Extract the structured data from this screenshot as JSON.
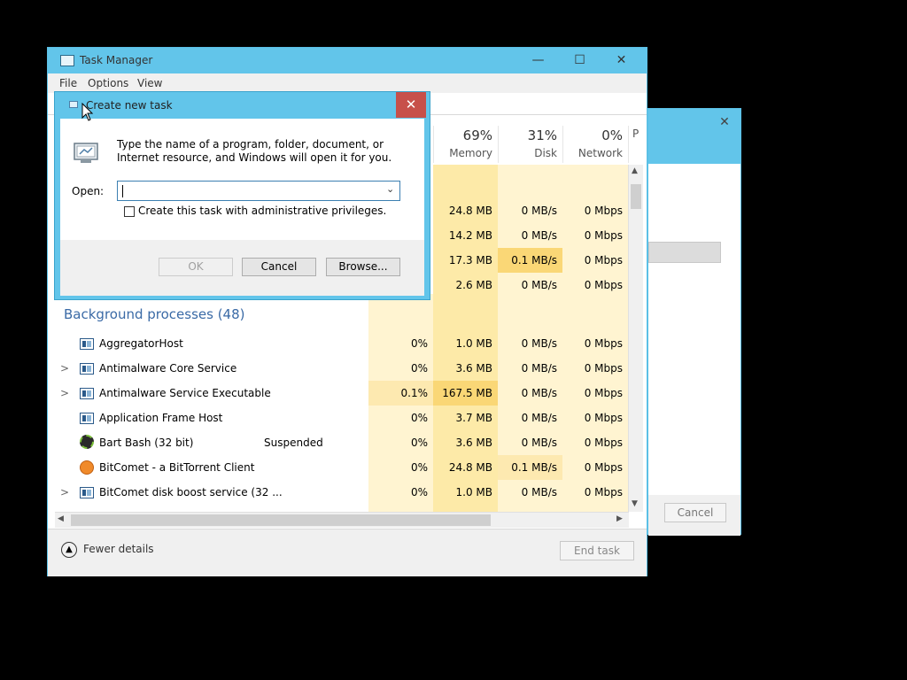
{
  "bg_window": {
    "cancel_label": "Cancel",
    "close_glyph": "✕"
  },
  "task_manager": {
    "title": "Task Manager",
    "menu": [
      "File",
      "Options",
      "View"
    ],
    "window_buttons": {
      "minimize": "—",
      "maximize": "☐",
      "close": "✕"
    },
    "columns": [
      {
        "pct": "69%",
        "label": "Memory"
      },
      {
        "pct": "31%",
        "label": "Disk"
      },
      {
        "pct": "0%",
        "label": "Network"
      },
      {
        "pct": "",
        "label": "P"
      }
    ],
    "app_rows": [
      {
        "memory": "24.8 MB",
        "disk": "0 MB/s",
        "network": "0 Mbps"
      },
      {
        "memory": "14.2 MB",
        "disk": "0 MB/s",
        "network": "0 Mbps"
      },
      {
        "memory": "17.3 MB",
        "disk": "0.1 MB/s",
        "network": "0 Mbps"
      },
      {
        "memory": "2.6 MB",
        "disk": "0 MB/s",
        "network": "0 Mbps"
      }
    ],
    "background_section": "Background processes (48)",
    "processes": [
      {
        "name": "AggregatorHost",
        "status": "",
        "cpu": "0%",
        "memory": "1.0 MB",
        "disk": "0 MB/s",
        "network": "0 Mbps",
        "expand": ""
      },
      {
        "name": "Antimalware Core Service",
        "status": "",
        "cpu": "0%",
        "memory": "3.6 MB",
        "disk": "0 MB/s",
        "network": "0 Mbps",
        "expand": ">"
      },
      {
        "name": "Antimalware Service Executable",
        "status": "",
        "cpu": "0.1%",
        "memory": "167.5 MB",
        "disk": "0 MB/s",
        "network": "0 Mbps",
        "expand": ">"
      },
      {
        "name": "Application Frame Host",
        "status": "",
        "cpu": "0%",
        "memory": "3.7 MB",
        "disk": "0 MB/s",
        "network": "0 Mbps",
        "expand": ""
      },
      {
        "name": "Bart Bash (32 bit)",
        "status": "Suspended",
        "cpu": "0%",
        "memory": "3.6 MB",
        "disk": "0 MB/s",
        "network": "0 Mbps",
        "expand": ""
      },
      {
        "name": "BitComet - a BitTorrent Client",
        "status": "",
        "cpu": "0%",
        "memory": "24.8 MB",
        "disk": "0.1 MB/s",
        "network": "0 Mbps",
        "expand": ""
      },
      {
        "name": "BitComet disk boost service (32 ...",
        "status": "",
        "cpu": "0%",
        "memory": "1.0 MB",
        "disk": "0 MB/s",
        "network": "0 Mbps",
        "expand": ">"
      }
    ],
    "footer": {
      "fewer_details": "Fewer details",
      "end_task": "End task"
    }
  },
  "dialog": {
    "title": "Create new task",
    "close_glyph": "✕",
    "description": "Type the name of a program, folder, document, or Internet resource, and Windows will open it for you.",
    "open_label": "Open:",
    "open_value": "",
    "admin_checkbox_label": "Create this task with administrative privileges.",
    "buttons": {
      "ok": "OK",
      "cancel": "Cancel",
      "browse": "Browse..."
    }
  },
  "colors": {
    "accent": "#62c5ea",
    "heat_light": "#fff4d1",
    "heat_mid": "#fde9b0",
    "heat_strong": "#fad776",
    "close_red": "#c7504a",
    "section_blue": "#3a6aa6"
  }
}
